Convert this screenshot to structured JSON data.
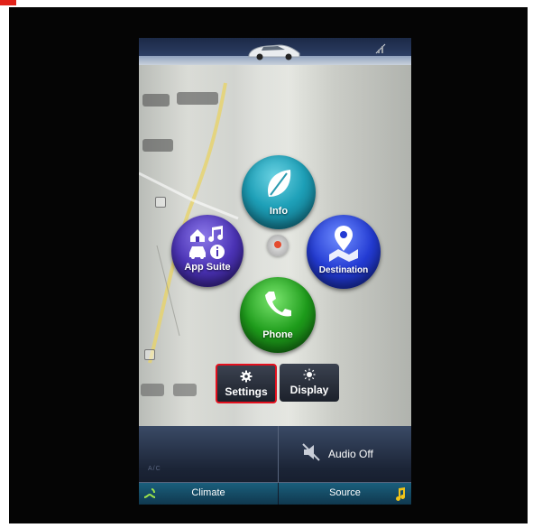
{
  "menu": {
    "info_label": "Info",
    "app_suite_label": "App Suite",
    "destination_label": "Destination",
    "phone_label": "Phone"
  },
  "tiles": {
    "settings_label": "Settings",
    "display_label": "Display"
  },
  "bottom": {
    "audio_off_label": "Audio Off",
    "climate_label": "Climate",
    "source_label": "Source",
    "climate_ghost_text": "A/C"
  },
  "colors": {
    "highlight": "#e3101e",
    "info": "#1ea0b8",
    "app_suite": "#4b33b6",
    "destination": "#233bd3",
    "phone": "#1e9c1b",
    "accent_icon": "#f0c419"
  }
}
